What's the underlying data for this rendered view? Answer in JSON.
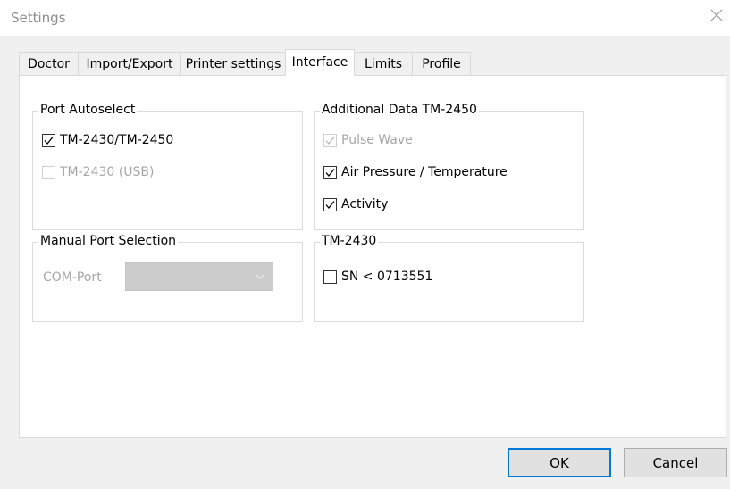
{
  "window": {
    "title": "Settings"
  },
  "tabs": [
    {
      "label": "Doctor"
    },
    {
      "label": "Import/Export"
    },
    {
      "label": "Printer settings"
    },
    {
      "label": "Interface"
    },
    {
      "label": "Limits"
    },
    {
      "label": "Profile"
    }
  ],
  "active_tab": "Interface",
  "port_autoselect": {
    "title": "Port Autoselect",
    "options": [
      {
        "label": "TM-2430/TM-2450",
        "checked": true,
        "enabled": true
      },
      {
        "label": "TM-2430 (USB)",
        "checked": false,
        "enabled": false
      }
    ]
  },
  "manual_port": {
    "title": "Manual Port Selection",
    "com_label": "COM-Port",
    "com_value": ""
  },
  "additional_data": {
    "title": "Additional Data TM-2450",
    "options": [
      {
        "label": "Pulse Wave",
        "checked": true,
        "enabled": false
      },
      {
        "label": "Air Pressure / Temperature",
        "checked": true,
        "enabled": true
      },
      {
        "label": "Activity",
        "checked": true,
        "enabled": true
      }
    ]
  },
  "tm2430": {
    "title": "TM-2430",
    "options": [
      {
        "label": "SN < 0713551",
        "checked": false,
        "enabled": true
      }
    ]
  },
  "buttons": {
    "ok": "OK",
    "cancel": "Cancel"
  },
  "colors": {
    "accent": "#0078d7",
    "disabled_text": "#a6a6a6",
    "panel": "#ffffff",
    "chrome": "#f0f0f0"
  }
}
